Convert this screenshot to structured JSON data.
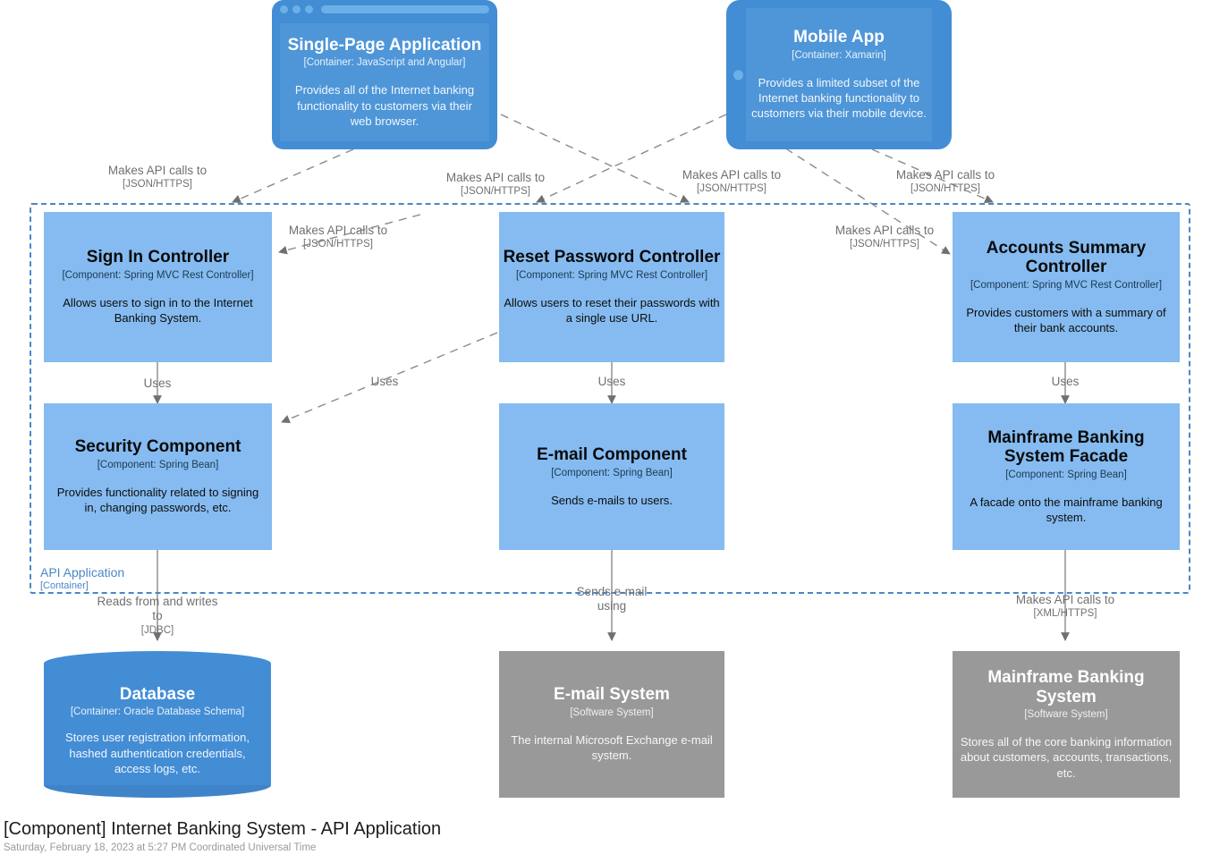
{
  "diagram": {
    "caption_title": "[Component] Internet Banking System - API Application",
    "caption_date": "Saturday, February 18, 2023 at 5:27 PM Coordinated Universal Time",
    "colors": {
      "container_blue": "#438dd5",
      "component_blue": "#85bbf0",
      "external_grey": "#999999",
      "boundary_blue": "#4a87c7",
      "edge_grey": "#707070"
    }
  },
  "boundary": {
    "name": "API Application",
    "tech": "[Container]"
  },
  "nodes": {
    "spa": {
      "title": "Single-Page Application",
      "tech": "[Container: JavaScript and Angular]",
      "desc": "Provides all of the Internet banking functionality to customers via their web browser.",
      "shape": "web-browser"
    },
    "mobile": {
      "title": "Mobile App",
      "tech": "[Container: Xamarin]",
      "desc": "Provides a limited subset of the Internet banking functionality to customers via their mobile device.",
      "shape": "mobile-device"
    },
    "signin": {
      "title": "Sign In Controller",
      "tech": "[Component: Spring MVC Rest Controller]",
      "desc": "Allows users to sign in to the Internet Banking System.",
      "shape": "box"
    },
    "reset": {
      "title": "Reset Password Controller",
      "tech": "[Component: Spring MVC Rest Controller]",
      "desc": "Allows users to reset their passwords with a single use URL.",
      "shape": "box"
    },
    "accounts": {
      "title": "Accounts Summary Controller",
      "tech": "[Component: Spring MVC Rest Controller]",
      "desc": "Provides customers with a summary of their bank accounts.",
      "shape": "box"
    },
    "security": {
      "title": "Security Component",
      "tech": "[Component: Spring Bean]",
      "desc": "Provides functionality related to signing in, changing passwords, etc.",
      "shape": "box"
    },
    "email_component": {
      "title": "E-mail Component",
      "tech": "[Component: Spring Bean]",
      "desc": "Sends e-mails to users.",
      "shape": "box"
    },
    "mainframe_facade": {
      "title": "Mainframe Banking System Facade",
      "tech": "[Component: Spring Bean]",
      "desc": "A facade onto the mainframe banking system.",
      "shape": "box"
    },
    "database": {
      "title": "Database",
      "tech": "[Container: Oracle Database Schema]",
      "desc": "Stores user registration information, hashed authentication credentials, access logs, etc.",
      "shape": "cylinder"
    },
    "email_system": {
      "title": "E-mail System",
      "tech": "[Software System]",
      "desc": "The internal Microsoft Exchange e-mail system.",
      "shape": "box"
    },
    "mainframe_system": {
      "title": "Mainframe Banking System",
      "tech": "[Software System]",
      "desc": "Stores all of the core banking information about customers, accounts, transactions, etc.",
      "shape": "box"
    }
  },
  "edges": [
    {
      "id": "spa-signin",
      "label": "Makes API calls to",
      "tech": "[JSON/HTTPS]"
    },
    {
      "id": "spa-reset",
      "label": "Makes API calls to",
      "tech": "[JSON/HTTPS]"
    },
    {
      "id": "mobile-reset",
      "label": "Makes API calls to",
      "tech": "[JSON/HTTPS]"
    },
    {
      "id": "mobile-accounts",
      "label": "Makes API calls to",
      "tech": "[JSON/HTTPS]"
    },
    {
      "id": "spa-signin-inner",
      "label": "Makes API calls to",
      "tech": "[JSON/HTTPS]"
    },
    {
      "id": "spa-accounts-inner",
      "label": "Makes API calls to",
      "tech": "[JSON/HTTPS]"
    },
    {
      "id": "signin-security",
      "label": "Uses",
      "tech": ""
    },
    {
      "id": "reset-security",
      "label": "Uses",
      "tech": ""
    },
    {
      "id": "reset-email",
      "label": "Uses",
      "tech": ""
    },
    {
      "id": "accounts-facade",
      "label": "Uses",
      "tech": ""
    },
    {
      "id": "security-database",
      "label": "Reads from and writes to",
      "tech": "[JDBC]"
    },
    {
      "id": "email-emailsystem",
      "label": "Sends e-mail using",
      "tech": ""
    },
    {
      "id": "facade-mainframe",
      "label": "Makes API calls to",
      "tech": "[XML/HTTPS]"
    }
  ]
}
